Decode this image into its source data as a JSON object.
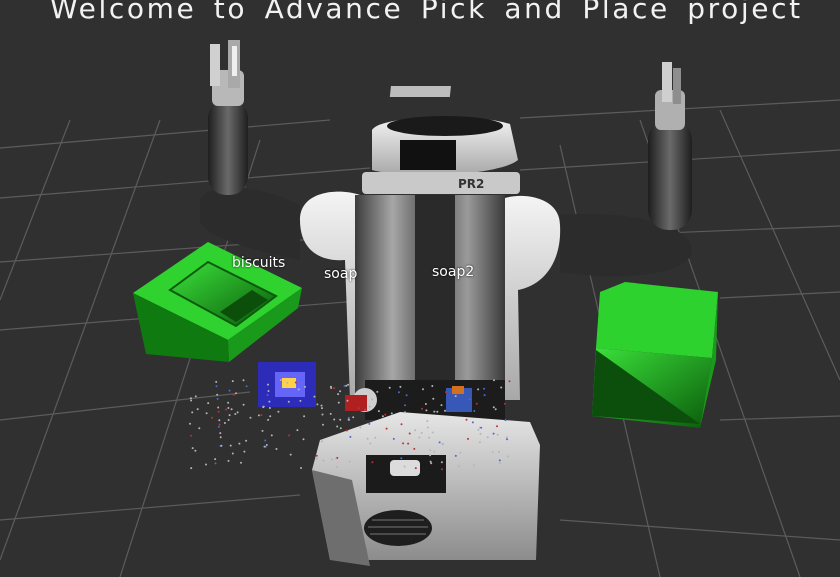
{
  "overlay": {
    "title": "Welcome to Advance Pick and Place project"
  },
  "robot": {
    "badge": "PR2"
  },
  "labels": {
    "biscuits": "biscuits",
    "soap": "soap",
    "soap2": "soap2"
  },
  "colors": {
    "background": "#303030",
    "grid": "#5c5c5c",
    "bin": "#1fae1f",
    "text": "#ffffff"
  }
}
